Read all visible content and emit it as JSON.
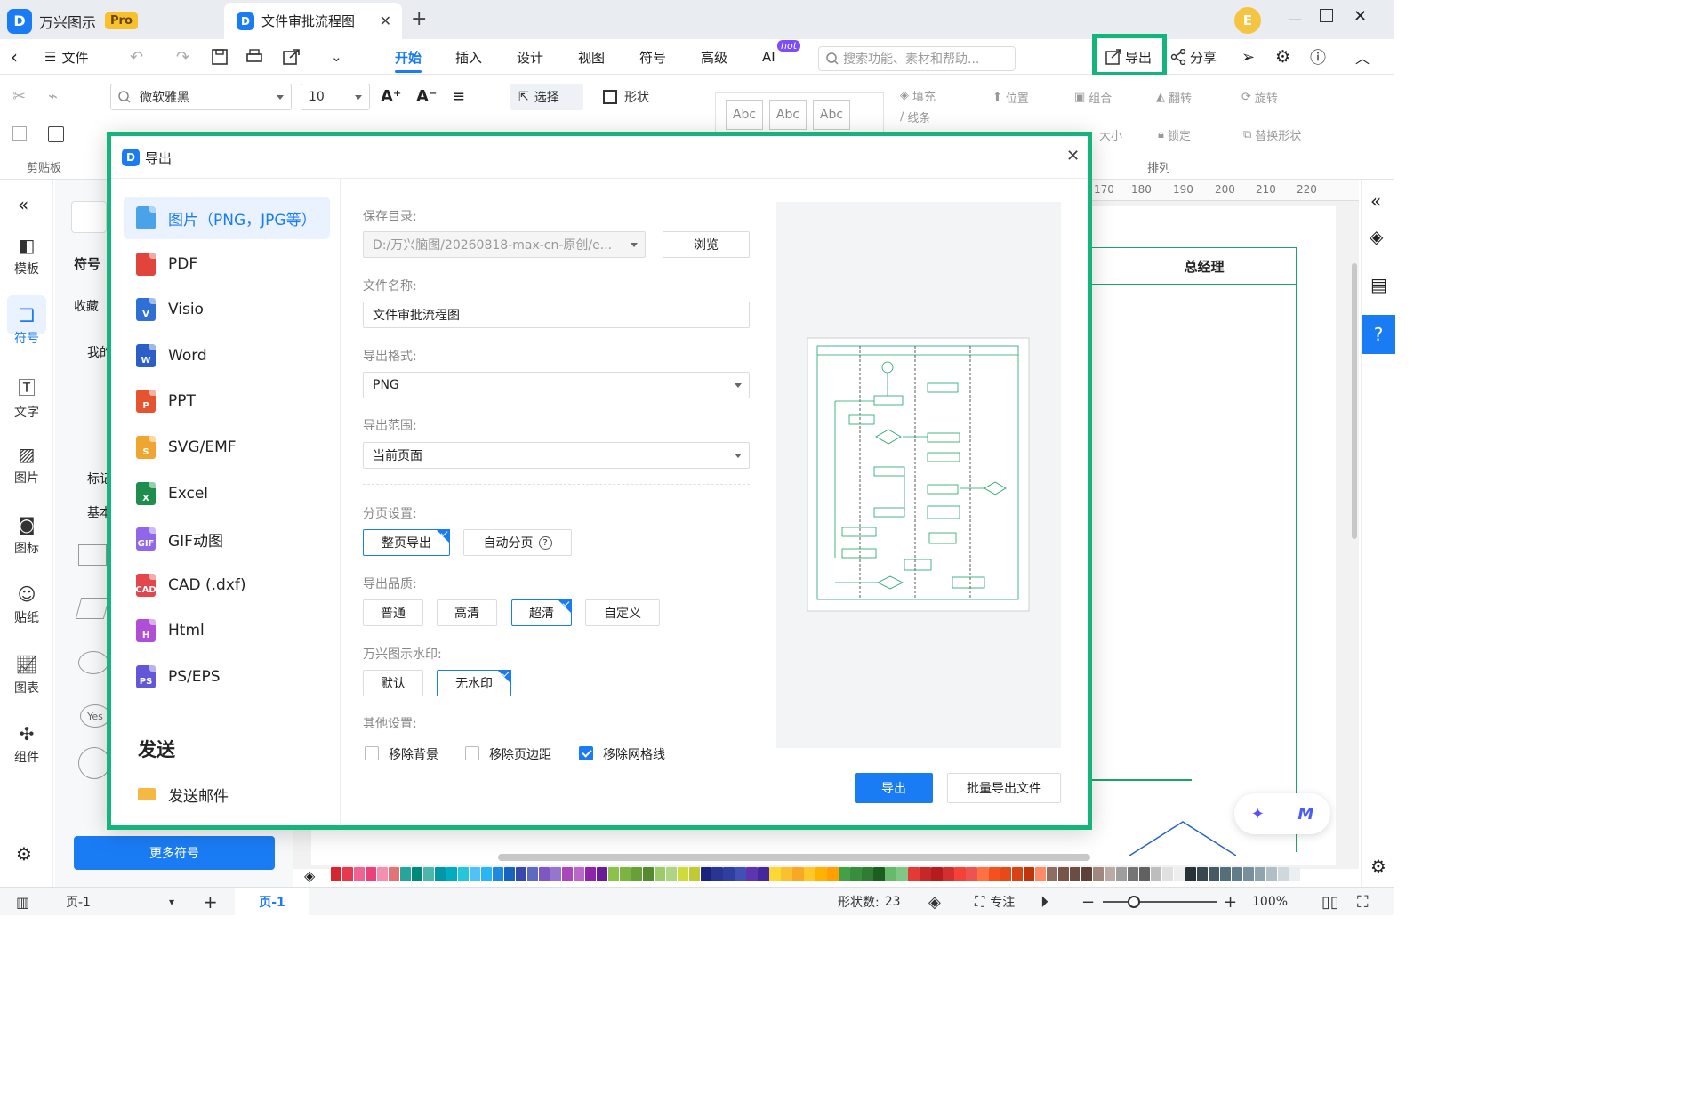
{
  "app": {
    "name": "万兴图示",
    "badge": "Pro",
    "doc_tab": "文件审批流程图",
    "user_initial": "E"
  },
  "menu": {
    "file": "文件",
    "tabs": [
      "开始",
      "插入",
      "设计",
      "视图",
      "符号",
      "高级",
      "AI"
    ],
    "ai_badge": "hot",
    "search_placeholder": "搜索功能、素材和帮助...",
    "export": "导出",
    "share": "分享"
  },
  "ribbon": {
    "font_name": "微软雅黑",
    "font_size": "10",
    "select": "选择",
    "shape": "形状",
    "style_sample": "Abc",
    "fill": "填充",
    "line": "线条",
    "position": "位置",
    "group": "组合",
    "flip": "翻转",
    "rotate": "旋转",
    "size": "大小",
    "lock": "锁定",
    "replace_shape": "替换形状",
    "clipboard": "剪贴板",
    "arrange": "排列"
  },
  "leftbar": [
    "模板",
    "符号",
    "文字",
    "图片",
    "图标",
    "贴纸",
    "图表",
    "组件"
  ],
  "sympanel": {
    "title": "符号",
    "favorites": "收藏",
    "mine": "我的",
    "mark": "标记",
    "basic": "基本",
    "more_button": "更多符号",
    "yes": "Yes"
  },
  "canvas": {
    "ruler_ticks": [
      "170",
      "180",
      "190",
      "200",
      "210",
      "220"
    ],
    "lane_title": "总经理"
  },
  "palette": [
    "#d9232e",
    "#e8384f",
    "#f06292",
    "#ec407a",
    "#f48fb1",
    "#e57373",
    "#26a69a",
    "#00897b",
    "#4db6ac",
    "#0097a7",
    "#00acc1",
    "#26c6da",
    "#4fc3f7",
    "#29b6f6",
    "#1e88e5",
    "#1565c0",
    "#3949ab",
    "#5c6bc0",
    "#7e57c2",
    "#9575cd",
    "#ab47bc",
    "#ba68c8",
    "#8e24aa",
    "#6a1b9a",
    "#8bc34a",
    "#7cb342",
    "#689f38",
    "#558b2f",
    "#9ccc65",
    "#aed581",
    "#cddc39",
    "#c0ca33",
    "#1a237e",
    "#283593",
    "#303f9f",
    "#3f51b5",
    "#5e35b1",
    "#4527a0",
    "#fdd835",
    "#fbc02d",
    "#f9a825",
    "#ffca28",
    "#ffb300",
    "#ffa000",
    "#43a047",
    "#388e3c",
    "#2e7d32",
    "#1b5e20",
    "#66bb6a",
    "#81c784",
    "#e53935",
    "#c62828",
    "#b71c1c",
    "#d32f2f",
    "#f44336",
    "#ef5350",
    "#ff7043",
    "#f4511e",
    "#e64a19",
    "#d84315",
    "#bf360c",
    "#ff8a65",
    "#8d6e63",
    "#795548",
    "#6d4c41",
    "#5d4037",
    "#a1887f",
    "#bcaaa4",
    "#9e9e9e",
    "#757575",
    "#616161",
    "#bdbdbd",
    "#e0e0e0",
    "#eeeeee",
    "#263238",
    "#37474f",
    "#455a64",
    "#546e7a",
    "#607d8b",
    "#78909c",
    "#90a4ae",
    "#b0bec5",
    "#cfd8dc",
    "#eceff1"
  ],
  "status": {
    "page_select": "页-1",
    "page_tab": "页-1",
    "shapes_label": "形状数:",
    "shapes_count": "23",
    "focus": "专注",
    "zoom": "100%"
  },
  "dialog": {
    "title": "导出",
    "formats": [
      "图片（PNG，JPG等）",
      "PDF",
      "Visio",
      "Word",
      "PPT",
      "SVG/EMF",
      "Excel",
      "GIF动图",
      "CAD (.dxf)",
      "Html",
      "PS/EPS"
    ],
    "format_icons": [
      "image-icon",
      "pdf-icon",
      "visio-icon",
      "word-icon",
      "ppt-icon",
      "svg-icon",
      "excel-icon",
      "gif-icon",
      "cad-icon",
      "html-icon",
      "ps-icon"
    ],
    "format_letters": [
      "",
      "",
      "V",
      "W",
      "P",
      "S",
      "X",
      "GIF",
      "CAD",
      "H",
      "PS"
    ],
    "format_colors": [
      "#4aa3e8",
      "#e0443a",
      "#2f6fd6",
      "#2b5fc7",
      "#e5532f",
      "#f1a531",
      "#1f8e4d",
      "#8f67e8",
      "#e2474e",
      "#b04fd6",
      "#6257d6"
    ],
    "send_heading": "发送",
    "send_email": "发送邮件",
    "save_dir_label": "保存目录:",
    "save_dir": "D:/万兴脑图/20260818-max-cn-原创/e...",
    "browse": "浏览",
    "file_name_label": "文件名称:",
    "file_name": "文件审批流程图",
    "format_label": "导出格式:",
    "format": "PNG",
    "range_label": "导出范围:",
    "range": "当前页面",
    "paging_label": "分页设置:",
    "paging_options": [
      "整页导出",
      "自动分页"
    ],
    "paging_selected": "整页导出",
    "quality_label": "导出品质:",
    "quality_options": [
      "普通",
      "高清",
      "超清",
      "自定义"
    ],
    "quality_selected": "超清",
    "watermark_label": "万兴图示水印:",
    "watermark_options": [
      "默认",
      "无水印"
    ],
    "watermark_selected": "无水印",
    "other_label": "其他设置:",
    "checks": [
      {
        "label": "移除背景",
        "checked": false
      },
      {
        "label": "移除页边距",
        "checked": false
      },
      {
        "label": "移除网格线",
        "checked": true
      }
    ],
    "export_button": "导出",
    "batch_button": "批量导出文件"
  },
  "colors": {
    "accent": "#1a7cf5",
    "highlight": "#13b57a",
    "flow": "#1ca36a"
  }
}
